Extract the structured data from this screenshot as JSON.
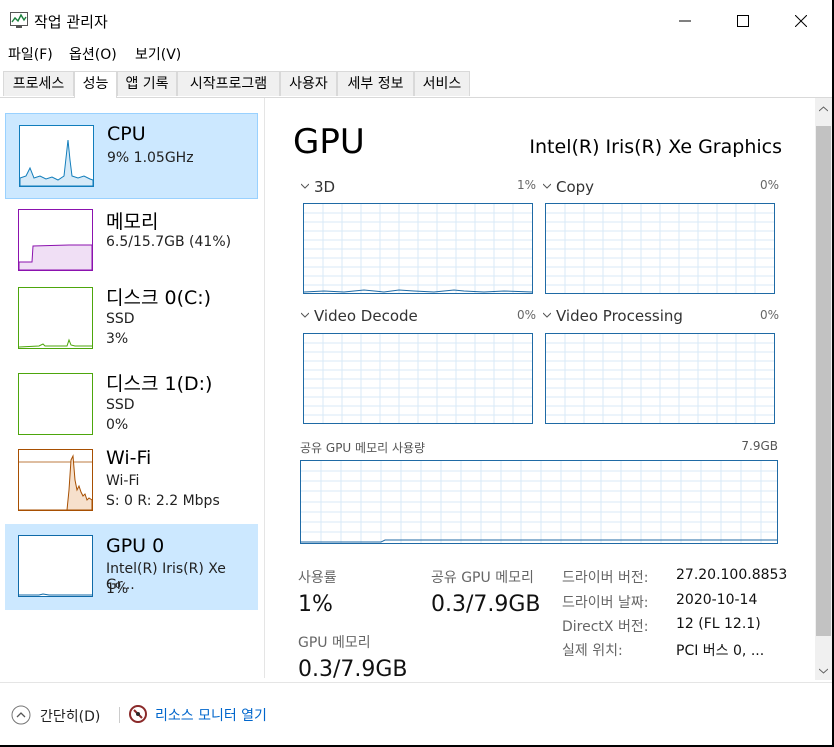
{
  "window": {
    "title": "작업 관리자"
  },
  "menu": [
    "파일(F)",
    "옵션(O)",
    "보기(V)"
  ],
  "tabs": [
    "프로세스",
    "성능",
    "앱 기록",
    "시작프로그램",
    "사용자",
    "세부 정보",
    "서비스"
  ],
  "active_tab": 1,
  "sidebar": [
    {
      "name": "CPU",
      "line1": "9% 1.05GHz",
      "line2": "",
      "color": "#117dbb"
    },
    {
      "name": "메모리",
      "line1": "6.5/15.7GB (41%)",
      "line2": "",
      "color": "#8b12ae"
    },
    {
      "name": "디스크 0(C:)",
      "line1": "SSD",
      "line2": "3%",
      "color": "#4da60c"
    },
    {
      "name": "디스크 1(D:)",
      "line1": "SSD",
      "line2": "0%",
      "color": "#4da60c"
    },
    {
      "name": "Wi-Fi",
      "line1": "Wi-Fi",
      "line2": "S: 0 R: 2.2 Mbps",
      "color": "#a74f01"
    },
    {
      "name": "GPU 0",
      "line1": "Intel(R) Iris(R) Xe Gr...",
      "line2": "1%",
      "color": "#0f6aa8"
    }
  ],
  "gpu": {
    "title": "GPU",
    "model": "Intel(R) Iris(R) Xe Graphics",
    "engines": [
      {
        "label": "3D",
        "pct": "1%"
      },
      {
        "label": "Copy",
        "pct": "0%"
      },
      {
        "label": "Video Decode",
        "pct": "0%"
      },
      {
        "label": "Video Processing",
        "pct": "0%"
      }
    ],
    "shared_label": "공유 GPU 메모리 사용량",
    "shared_max": "7.9GB",
    "stats": {
      "util_label": "사용률",
      "util_value": "1%",
      "shared_label": "공유 GPU 메모리",
      "shared_value": "0.3/7.9GB",
      "gpumem_label": "GPU 메모리",
      "gpumem_value": "0.3/7.9GB"
    },
    "info": [
      {
        "label": "드라이버 버전:",
        "value": "27.20.100.8853"
      },
      {
        "label": "드라이버 날짜:",
        "value": "2020-10-14"
      },
      {
        "label": "DirectX 버전:",
        "value": "12 (FL 12.1)"
      },
      {
        "label": "실제 위치:",
        "value": "PCI 버스 0, ..."
      }
    ]
  },
  "footer": {
    "fewer_details": "간단히(D)",
    "resource_monitor": "리소스 모니터 열기"
  },
  "colors": {
    "accent_selected": "#cce8ff",
    "link": "#0066cc",
    "gpu_graph": "#1f6aa5"
  }
}
